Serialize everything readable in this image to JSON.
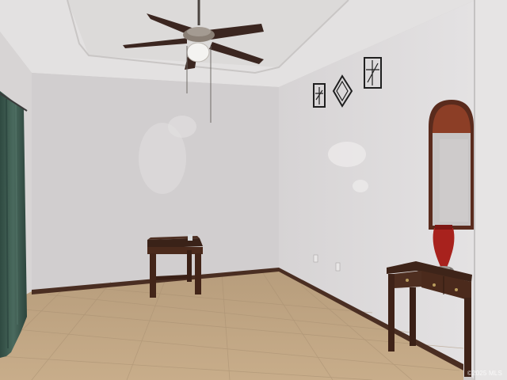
{
  "photo": {
    "subject": "empty-room-interior",
    "watermark": "©2025 MLS"
  },
  "colors": {
    "wall_left": "#d9d6d6",
    "wall_back": "#d3d0d0",
    "wall_right": "#dcd9da",
    "ceiling": "#e2e0e0",
    "floor_tile": "#c2a886",
    "baseboard": "#4a2e22",
    "wood": "#4b2a1c",
    "curtain": "#3d5a50",
    "vase": "#a8221d"
  },
  "icons": [
    "ceiling-fan-icon",
    "wall-art-icon",
    "mirror-icon",
    "vase-icon"
  ]
}
